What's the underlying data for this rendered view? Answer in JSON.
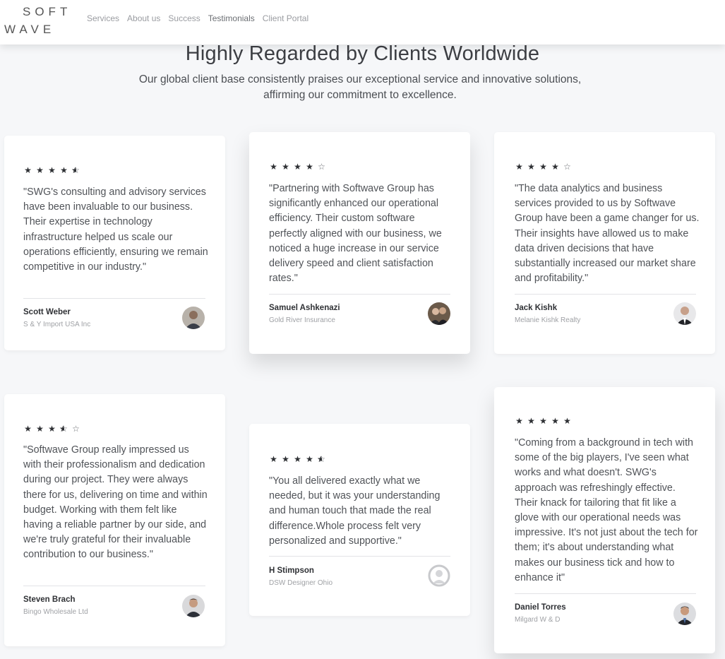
{
  "brand": {
    "line1": "SOFT",
    "line2": "WAVE"
  },
  "nav": [
    {
      "label": "Services"
    },
    {
      "label": "About us"
    },
    {
      "label": "Success"
    },
    {
      "label": "Testimonials"
    },
    {
      "label": "Client Portal"
    }
  ],
  "section": {
    "title": "Highly Regarded by Clients Worldwide",
    "subtitle": "Our global client base consistently praises our exceptional service and innovative solutions, affirming our commitment to excellence."
  },
  "testimonials": [
    {
      "rating": 4.5,
      "quote": "\"SWG's consulting and advisory services have been invaluable to our business. Their expertise in technology infrastructure helped us scale our operations efficiently, ensuring we remain competitive in our industry.\"",
      "name": "Scott Weber",
      "company": "S & Y Import USA Inc",
      "avatar_icon": "person-photo-avatar"
    },
    {
      "rating": 4,
      "quote": "\"Partnering with Softwave Group has significantly enhanced our operational efficiency. Their custom software perfectly aligned with our business, we noticed a huge increase in our service delivery speed and client satisfaction rates.\"",
      "name": "Samuel Ashkenazi",
      "company": "Gold River Insurance",
      "avatar_icon": "couple-photo-avatar"
    },
    {
      "rating": 4,
      "quote": "\"The data analytics and business services provided to us by Softwave Group have been a game changer for us. Their insights have allowed us to make data driven decisions that have substantially increased our market share and profitability.\"",
      "name": "Jack Kishk",
      "company": "Melanie Kishk Realty",
      "avatar_icon": "person-photo-avatar"
    },
    {
      "rating": 3.5,
      "quote": "\"Softwave Group really impressed us with their professionalism and dedication during our project. They were always there for us, delivering on time and within budget. Working with them felt like having a reliable partner by our side, and we're truly grateful for their invaluable contribution to our business.\"",
      "name": "Steven Brach",
      "company": "Bingo Wholesale Ltd",
      "avatar_icon": "person-photo-avatar"
    },
    {
      "rating": 4.5,
      "quote": "\"You all delivered exactly what we needed, but it was your understanding and human touch that made the real difference.Whole process felt very personalized and supportive.\"",
      "name": "H Stimpson",
      "company": "DSW Designer Ohio",
      "avatar_icon": "default-user-avatar"
    },
    {
      "rating": 5,
      "quote": "\"Coming from a background in tech with some of the big players, I've seen what works and what doesn't. SWG's approach was refreshingly effective. Their knack for tailoring that fit like a glove with our operational needs was impressive. It's not just about the tech for them; it's about understanding what makes our business tick and how to enhance it\"",
      "name": "Daniel Torres",
      "company": "Milgard W & D",
      "avatar_icon": "person-photo-avatar"
    }
  ],
  "colors": {
    "star": "#2d2f33",
    "background": "#f6f7f9",
    "card": "#ffffff"
  }
}
